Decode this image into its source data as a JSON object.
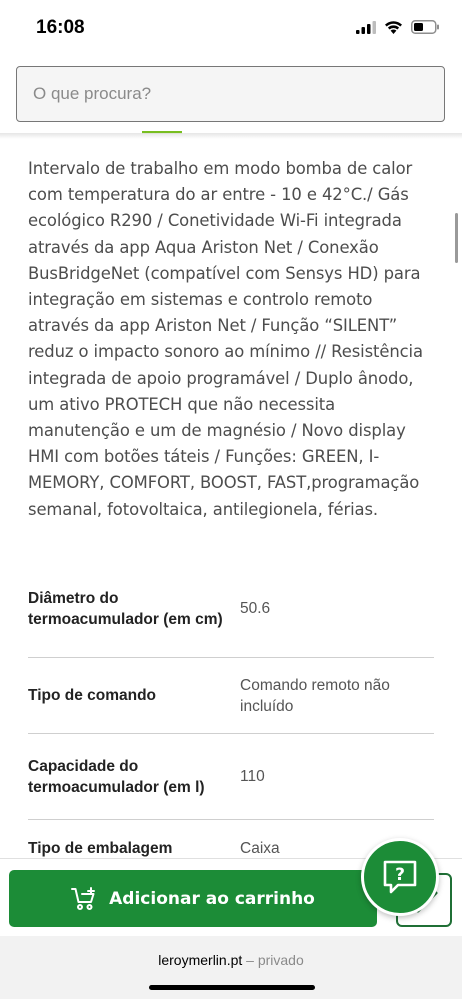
{
  "status_bar": {
    "time": "16:08"
  },
  "search": {
    "placeholder": "O que procura?"
  },
  "description": "Intervalo de trabalho em modo bomba de calor com temperatura do ar entre - 10 e 42°C./ Gás ecológico R290 / Conetividade Wi-Fi integrada através da app Aqua Ariston Net / Conexão BusBridgeNet (compatível com Sensys HD) para integração em sistemas e controlo remoto através da app Ariston Net / Função “SILENT” reduz o impacto sonoro ao mínimo // Resistência integrada de apoio programável / Duplo ânodo, um ativo PROTECH que não necessita manutenção e um de magnésio / Novo display HMI com botões táteis / Funções: GREEN, I-MEMORY, COMFORT, BOOST, FAST,programação semanal, fotovoltaica, antilegionela, férias.",
  "specs": [
    {
      "label": "Diâmetro do termoacumulador (em cm)",
      "value": "50.6"
    },
    {
      "label": "Tipo de comando",
      "value": "Comando remoto não incluído"
    },
    {
      "label": "Capacidade do termoacumulador (em l)",
      "value": "110"
    },
    {
      "label": "Tipo de embalagem",
      "value": "Caixa"
    }
  ],
  "cart_button": {
    "label": "Adicionar ao carrinho"
  },
  "help_button": {
    "glyph": "?"
  },
  "browser": {
    "domain": "leroymerlin.pt",
    "privacy": " – privado"
  },
  "colors": {
    "brand_green": "#1c8c37",
    "accent_green": "#78be20"
  },
  "icons": {
    "cart": "add-to-cart-icon",
    "help": "chat-question-icon",
    "edit": "pencil-icon",
    "signal": "cellular-signal-icon",
    "wifi": "wifi-icon",
    "battery": "battery-icon"
  }
}
